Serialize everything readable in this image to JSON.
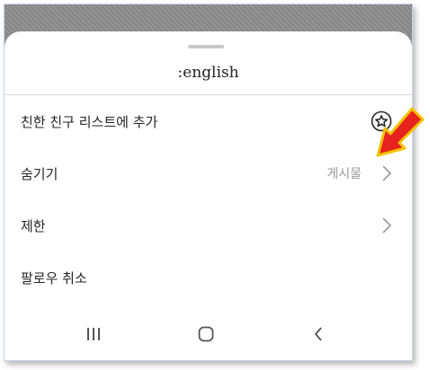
{
  "sheet": {
    "title": ":english"
  },
  "menu": {
    "items": [
      {
        "label": "친한 친구 리스트에 추가",
        "meta": "",
        "icon": "star-circle-icon"
      },
      {
        "label": "숨기기",
        "meta": "게시물",
        "icon": "chevron-right-icon"
      },
      {
        "label": "제한",
        "meta": "",
        "icon": "chevron-right-icon"
      },
      {
        "label": "팔로우 취소",
        "meta": "",
        "icon": ""
      }
    ]
  },
  "annotation": {
    "icon": "red-arrow-pointer",
    "color": "#e8231f",
    "outline": "#f2c200"
  },
  "navbar": {
    "items": [
      "recent-apps-icon",
      "home-icon",
      "back-icon"
    ]
  }
}
